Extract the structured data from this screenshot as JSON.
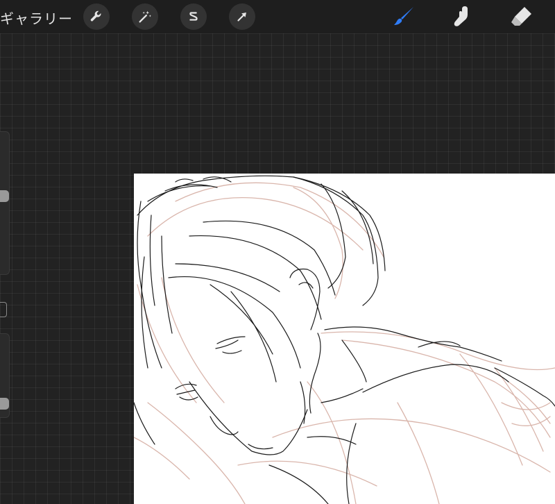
{
  "topbar": {
    "gallery_label": "ギャラリー",
    "tools_left": [
      {
        "icon": "wrench-icon",
        "name": "actions"
      },
      {
        "icon": "magic-wand-icon",
        "name": "adjustments"
      },
      {
        "icon": "selection-s-icon",
        "name": "selection"
      },
      {
        "icon": "arrow-cursor-icon",
        "name": "transform"
      }
    ],
    "tools_right": [
      {
        "icon": "brush-icon",
        "name": "paint",
        "active": true
      },
      {
        "icon": "smudge-finger-icon",
        "name": "smudge",
        "active": false
      },
      {
        "icon": "eraser-icon",
        "name": "erase",
        "active": false
      }
    ]
  },
  "colors": {
    "background": "#222222",
    "topbar": "#1e1e1e",
    "accent_active_tool": "#2f7cf6",
    "icon_default": "#e6e6e6",
    "sketch_line": "#1a1a1a",
    "sketch_underlayer": "#d9b5ab"
  },
  "sidebar": {
    "brush_size_level": 0.55,
    "opacity_level": 0.1
  }
}
